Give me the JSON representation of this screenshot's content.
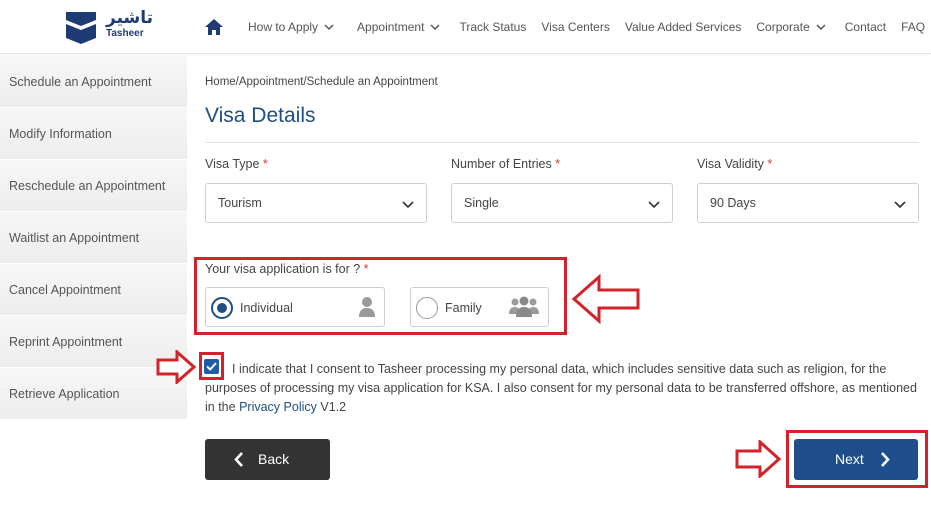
{
  "header": {
    "logo_arabic": "تاشير",
    "logo_english": "Tasheer",
    "nav": [
      {
        "label": "How to Apply",
        "dropdown": true
      },
      {
        "label": "Appointment",
        "dropdown": true
      },
      {
        "label": "Track Status",
        "dropdown": false
      },
      {
        "label": "Visa Centers",
        "dropdown": false
      },
      {
        "label": "Value Added Services",
        "dropdown": false
      },
      {
        "label": "Corporate",
        "dropdown": true
      },
      {
        "label": "Contact",
        "dropdown": false
      },
      {
        "label": "FAQ",
        "dropdown": false
      }
    ]
  },
  "sidebar": {
    "items": [
      {
        "label": "Schedule an Appointment"
      },
      {
        "label": "Modify Information"
      },
      {
        "label": "Reschedule an Appointment"
      },
      {
        "label": "Waitlist an Appointment"
      },
      {
        "label": "Cancel Appointment"
      },
      {
        "label": "Reprint Appointment"
      },
      {
        "label": "Retrieve Application"
      }
    ]
  },
  "main": {
    "breadcrumb": "Home/Appointment/Schedule an Appointment",
    "title": "Visa Details",
    "fields": {
      "visa_type": {
        "label": "Visa Type",
        "required_mark": "*",
        "value": "Tourism"
      },
      "entries": {
        "label": "Number of Entries",
        "required_mark": "*",
        "value": "Single"
      },
      "validity": {
        "label": "Visa Validity",
        "required_mark": "*",
        "value": "90 Days"
      }
    },
    "application_for": {
      "label": "Your visa application is for ?",
      "required_mark": "*",
      "options": [
        {
          "label": "Individual",
          "selected": true
        },
        {
          "label": "Family",
          "selected": false
        }
      ]
    },
    "consent": {
      "checked": true,
      "text": "I indicate that I consent to Tasheer processing my personal data, which includes sensitive data such as religion, for the purposes of processing my visa application for KSA. I also consent for my personal data to be transferred offshore, as mentioned in the",
      "link_text": "Privacy Policy",
      "version": "V1.2"
    },
    "buttons": {
      "back": "Back",
      "next": "Next"
    }
  },
  "colors": {
    "brand_blue": "#1e4f8c",
    "title_blue": "#1f4f82",
    "annotation_red": "#d2232a",
    "back_button": "#333333"
  }
}
